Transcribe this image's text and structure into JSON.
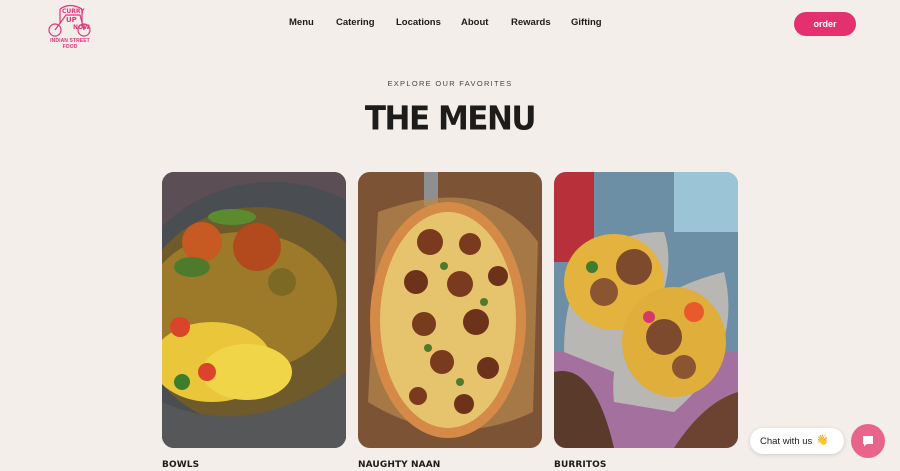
{
  "brand": {
    "logo_text_line1": "CURRY",
    "logo_text_line2": "UP",
    "logo_text_line3": "NOW",
    "tagline": "INDIAN STREET FOOD",
    "accent_color": "#e5306f"
  },
  "nav": {
    "items": [
      "Menu",
      "Catering",
      "Locations",
      "About",
      "Rewards",
      "Gifting"
    ],
    "order_label": "order"
  },
  "hero": {
    "eyebrow": "EXPLORE OUR FAVORITES",
    "title": "THE MENU"
  },
  "menu": {
    "cards": [
      {
        "label": "BOWLS",
        "image": "bowl-photo"
      },
      {
        "label": "NAUGHTY NAAN",
        "image": "naan-pizza-photo"
      },
      {
        "label": "BURRITOS",
        "image": "burrito-photo"
      }
    ]
  },
  "chat": {
    "label": "Chat with us",
    "wave": "👋",
    "button_icon": "chat-bubble-icon"
  }
}
